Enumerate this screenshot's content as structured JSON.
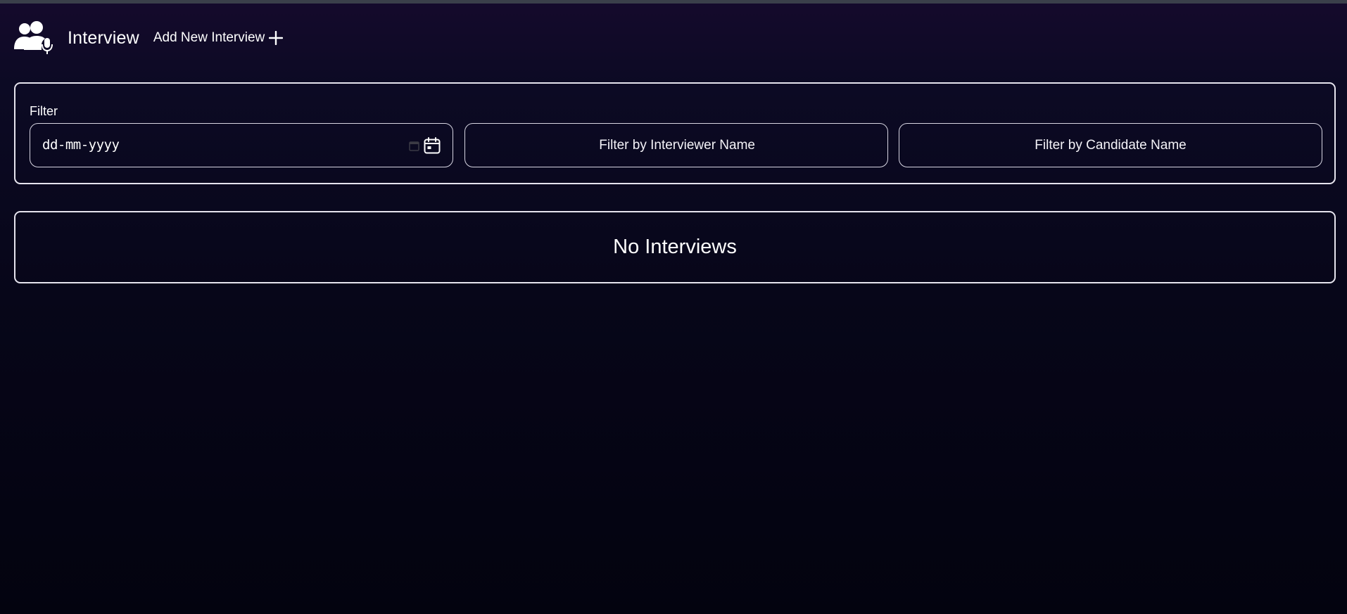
{
  "header": {
    "logo_icon": "users-mic-icon",
    "title": "Interview",
    "add_button_label": "Add New Interview",
    "add_icon": "plus-icon"
  },
  "filter": {
    "label": "Filter",
    "date": {
      "placeholder": "dd-mm-yyyy",
      "icon": "calendar-icon"
    },
    "interviewer": {
      "placeholder": "Filter by Interviewer Name"
    },
    "candidate": {
      "placeholder": "Filter by Candidate Name"
    }
  },
  "results": {
    "empty_message": "No Interviews"
  },
  "colors": {
    "background_top": "#150a2c",
    "background_bottom": "#03030f",
    "border": "#e6e4ee",
    "text": "#ffffff"
  }
}
